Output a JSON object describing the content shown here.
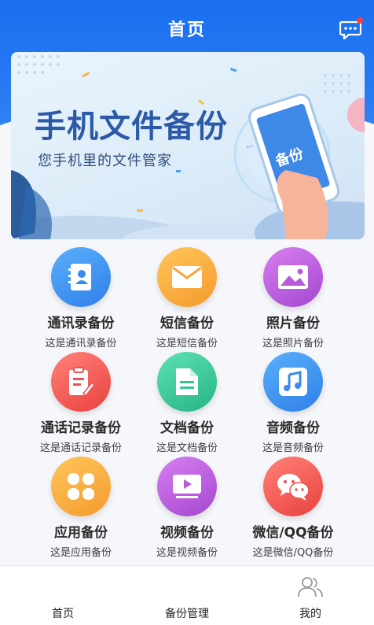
{
  "header": {
    "title": "首页",
    "message_icon": "chat-bubble-icon",
    "bg_color": "#1a6ff0"
  },
  "banner": {
    "title": "手机文件备份",
    "subtitle": "您手机里的文件管家",
    "phone_badge": "备份"
  },
  "features": [
    {
      "label": "通讯录备份",
      "desc": "这是通讯录备份",
      "icon": "contacts-book-icon",
      "color": "#2f8ef0"
    },
    {
      "label": "短信备份",
      "desc": "这是短信备份",
      "icon": "envelope-icon",
      "color": "#f7a93a"
    },
    {
      "label": "照片备份",
      "desc": "这是照片备份",
      "icon": "image-icon",
      "color": "#b45ad6"
    },
    {
      "label": "通话记录备份",
      "desc": "这是通话记录备份",
      "icon": "call-log-icon",
      "color": "#f05a55"
    },
    {
      "label": "文档备份",
      "desc": "这是文档备份",
      "icon": "document-icon",
      "color": "#3ec89a"
    },
    {
      "label": "音频备份",
      "desc": "这是音频备份",
      "icon": "music-note-icon",
      "color": "#2f8ef0"
    },
    {
      "label": "应用备份",
      "desc": "这是应用备份",
      "icon": "app-grid-icon",
      "color": "#f7a93a"
    },
    {
      "label": "视频备份",
      "desc": "这是视频备份",
      "icon": "video-play-icon",
      "color": "#b45ad6"
    },
    {
      "label": "微信/QQ备份",
      "desc": "这是微信/QQ备份",
      "icon": "wechat-icon",
      "color": "#f05a55"
    }
  ],
  "tabbar": {
    "items": [
      {
        "label": "首页"
      },
      {
        "label": "备份管理"
      },
      {
        "label": "我的",
        "icon": "user-group-icon"
      }
    ]
  }
}
